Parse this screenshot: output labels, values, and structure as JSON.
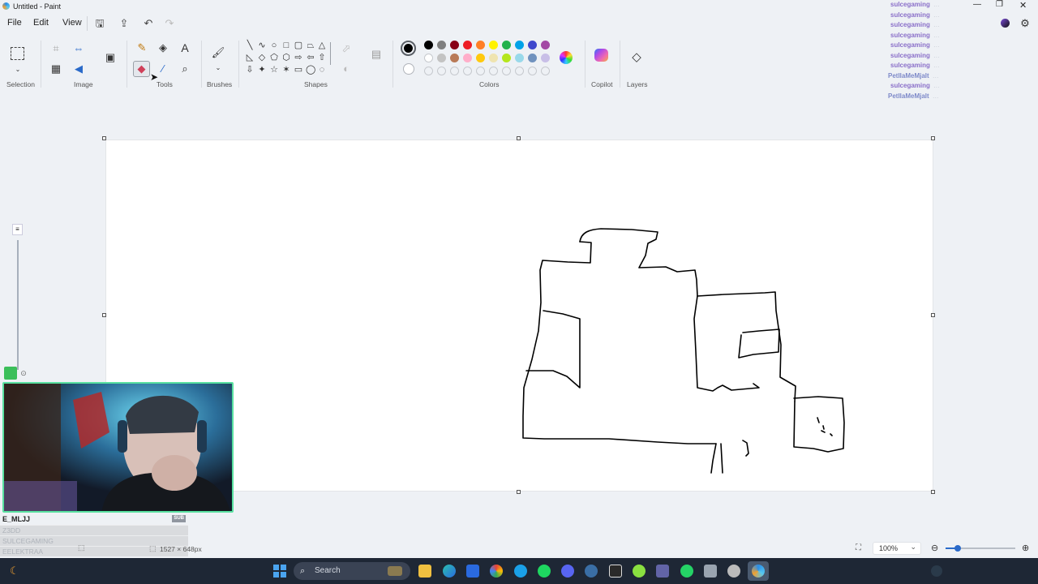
{
  "window": {
    "title": "Untitled - Paint"
  },
  "menu": {
    "file": "File",
    "edit": "Edit",
    "view": "View"
  },
  "ribbon": {
    "groups": {
      "selection": "Selection",
      "image": "Image",
      "tools": "Tools",
      "brushes": "Brushes",
      "shapes": "Shapes",
      "colors": "Colors",
      "copilot": "Copilot",
      "layers": "Layers"
    },
    "text_tool": "A",
    "palette_row1": [
      "#000000",
      "#7f7f7f",
      "#880015",
      "#ed1c24",
      "#ff7f27",
      "#fff200",
      "#22b14c",
      "#00a2e8",
      "#3f48cc",
      "#a349a4"
    ],
    "palette_row2": [
      "#ffffff",
      "#c3c3c3",
      "#b97a57",
      "#ffaec9",
      "#ffc90e",
      "#efe4b0",
      "#b5e61d",
      "#99d9ea",
      "#7092be",
      "#c8bfe7"
    ],
    "primary_color": "#000000",
    "secondary_color": "#ffffff"
  },
  "chat": [
    {
      "user": "sulcegaming",
      "msg": "…"
    },
    {
      "user": "sulcegaming",
      "msg": "…"
    },
    {
      "user": "sulcegaming",
      "msg": "…"
    },
    {
      "user": "sulcegaming",
      "msg": "…"
    },
    {
      "user": "sulcegaming",
      "msg": "…"
    },
    {
      "user": "sulcegaming",
      "msg": "…"
    },
    {
      "user": "sulcegaming",
      "msg": "…"
    },
    {
      "user": "PetllaMeMjalt",
      "msg": "…"
    },
    {
      "user": "sulcegaming",
      "msg": "…"
    },
    {
      "user": "PetllaMeMjalt",
      "msg": "…"
    }
  ],
  "viewers": {
    "top": "E_MLJJ",
    "badge": "SUB",
    "rows": [
      "Z3DD",
      "SULCEGAMING",
      "EELEKTRAA"
    ]
  },
  "status": {
    "canvas_size": "1527 × 648px",
    "zoom": "100%"
  },
  "taskbar": {
    "search_placeholder": "Search"
  }
}
